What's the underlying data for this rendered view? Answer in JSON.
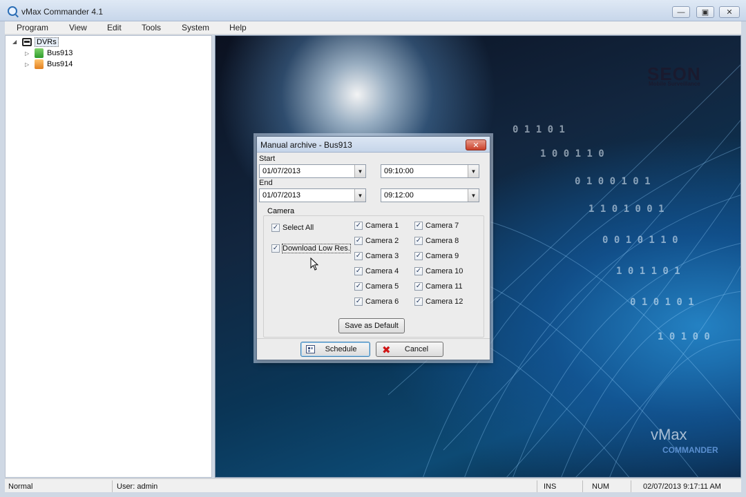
{
  "window": {
    "title": "vMax Commander 4.1",
    "min_glyph": "—",
    "max_glyph": "▣",
    "close_glyph": "✕"
  },
  "menu": [
    "Program",
    "View",
    "Edit",
    "Tools",
    "System",
    "Help"
  ],
  "tree": {
    "root": {
      "label": "DVRs",
      "icon": "bus-icon"
    },
    "items": [
      {
        "label": "Bus913",
        "icon": "dvr-green-icon"
      },
      {
        "label": "Bus914",
        "icon": "dvr-orange-icon"
      }
    ]
  },
  "background": {
    "brand_title": "SEON",
    "brand_subtitle": "Mobile Surveillance",
    "product_name": "vMax",
    "product_sub": "COMMANDER"
  },
  "dialog": {
    "title": "Manual archive - Bus913",
    "close_glyph": "✕",
    "start_label": "Start",
    "end_label": "End",
    "start_date": "01/07/2013",
    "start_time": "09:10:00",
    "end_date": "01/07/2013",
    "end_time": "09:12:00",
    "camera_group_label": "Camera",
    "select_all": {
      "label": "Select All",
      "checked": true
    },
    "download_low_res": {
      "label": "Download Low Res.",
      "checked": true
    },
    "cameras": [
      {
        "label": "Camera 1",
        "checked": true
      },
      {
        "label": "Camera 2",
        "checked": true
      },
      {
        "label": "Camera 3",
        "checked": true
      },
      {
        "label": "Camera 4",
        "checked": true
      },
      {
        "label": "Camera 5",
        "checked": true
      },
      {
        "label": "Camera 6",
        "checked": true
      },
      {
        "label": "Camera 7",
        "checked": true
      },
      {
        "label": "Camera 8",
        "checked": true
      },
      {
        "label": "Camera 9",
        "checked": true
      },
      {
        "label": "Camera 10",
        "checked": true
      },
      {
        "label": "Camera 11",
        "checked": true
      },
      {
        "label": "Camera 12",
        "checked": true
      }
    ],
    "save_default_label": "Save as Default",
    "schedule_label": "Schedule",
    "cancel_label": "Cancel"
  },
  "statusbar": {
    "mode": "Normal",
    "user": "User: admin",
    "ins": "INS",
    "num": "NUM",
    "datetime": "02/07/2013 9:17:11 AM"
  },
  "colors": {
    "titlebar": "#c7d6ea",
    "dialog_bg": "#ececec",
    "close_red": "#c9402a",
    "check_mark": "#2b3f63"
  }
}
